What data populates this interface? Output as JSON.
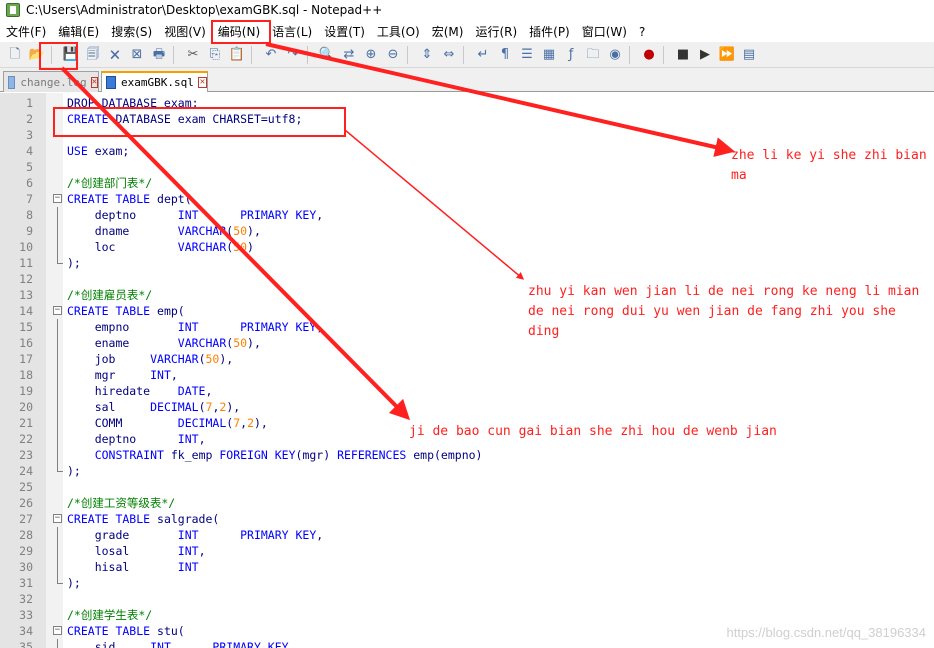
{
  "window": {
    "title": "C:\\Users\\Administrator\\Desktop\\examGBK.sql - Notepad++"
  },
  "menu": [
    "文件(F)",
    "编辑(E)",
    "搜索(S)",
    "视图(V)",
    "编码(N)",
    "语言(L)",
    "设置(T)",
    "工具(O)",
    "宏(M)",
    "运行(R)",
    "插件(P)",
    "窗口(W)",
    "?"
  ],
  "toolbar": {
    "icons": [
      "new-file-icon",
      "open-file-icon",
      "save-icon",
      "save-all-icon",
      "close-icon",
      "close-all-icon",
      "print-icon",
      "cut-icon",
      "copy-icon",
      "paste-icon",
      "undo-icon",
      "redo-icon",
      "find-icon",
      "replace-icon",
      "zoom-in-icon",
      "zoom-out-icon",
      "sync-v-icon",
      "sync-h-icon",
      "wrap-icon",
      "all-chars-icon",
      "indent-guide-icon",
      "doc-map-icon",
      "function-list-icon",
      "folder-workspace-icon",
      "monitor-icon",
      "record-macro-icon",
      "stop-record-icon",
      "play-macro-icon",
      "run-macro-multiple-icon",
      "save-macro-icon"
    ]
  },
  "tabs": [
    {
      "label": "change.log",
      "active": false
    },
    {
      "label": "examGBK.sql",
      "active": true
    }
  ],
  "lines": [
    {
      "n": "1",
      "fold": "",
      "segs": [
        {
          "t": "DROP DATABASE exam;",
          "c": "op"
        }
      ]
    },
    {
      "n": "2",
      "fold": "",
      "segs": [
        {
          "t": "CREATE",
          "c": "kw"
        },
        {
          "t": " DATABASE exam CHARSET=utf8;",
          "c": "op"
        }
      ]
    },
    {
      "n": "3",
      "fold": "",
      "segs": []
    },
    {
      "n": "4",
      "fold": "",
      "segs": [
        {
          "t": "USE",
          "c": "kw"
        },
        {
          "t": " exam;",
          "c": "op"
        }
      ]
    },
    {
      "n": "5",
      "fold": "",
      "segs": []
    },
    {
      "n": "6",
      "fold": "",
      "segs": [
        {
          "t": "/*创建部门表*/",
          "c": "cm"
        }
      ]
    },
    {
      "n": "7",
      "fold": "open",
      "segs": [
        {
          "t": "CREATE TABLE",
          "c": "kw"
        },
        {
          "t": " dept(",
          "c": "op"
        }
      ]
    },
    {
      "n": "8",
      "fold": "line",
      "segs": [
        {
          "t": "    deptno      ",
          "c": "op"
        },
        {
          "t": "INT",
          "c": "kw"
        },
        {
          "t": "      ",
          "c": "op"
        },
        {
          "t": "PRIMARY KEY",
          "c": "kw"
        },
        {
          "t": ",",
          "c": "op"
        }
      ]
    },
    {
      "n": "9",
      "fold": "line",
      "segs": [
        {
          "t": "    dname       ",
          "c": "op"
        },
        {
          "t": "VARCHAR",
          "c": "kw"
        },
        {
          "t": "(",
          "c": "op"
        },
        {
          "t": "50",
          "c": "num"
        },
        {
          "t": "),",
          "c": "op"
        }
      ]
    },
    {
      "n": "10",
      "fold": "line",
      "segs": [
        {
          "t": "    loc         ",
          "c": "op"
        },
        {
          "t": "VARCHAR",
          "c": "kw"
        },
        {
          "t": "(",
          "c": "op"
        },
        {
          "t": "50",
          "c": "num"
        },
        {
          "t": ")",
          "c": "op"
        }
      ]
    },
    {
      "n": "11",
      "fold": "end",
      "segs": [
        {
          "t": ");",
          "c": "op"
        }
      ]
    },
    {
      "n": "12",
      "fold": "",
      "segs": []
    },
    {
      "n": "13",
      "fold": "",
      "segs": [
        {
          "t": "/*创建雇员表*/",
          "c": "cm"
        }
      ]
    },
    {
      "n": "14",
      "fold": "open",
      "segs": [
        {
          "t": "CREATE TABLE",
          "c": "kw"
        },
        {
          "t": " emp(",
          "c": "op"
        }
      ]
    },
    {
      "n": "15",
      "fold": "line",
      "segs": [
        {
          "t": "    empno       ",
          "c": "op"
        },
        {
          "t": "INT",
          "c": "kw"
        },
        {
          "t": "      ",
          "c": "op"
        },
        {
          "t": "PRIMARY KEY",
          "c": "kw"
        },
        {
          "t": ",",
          "c": "op"
        }
      ]
    },
    {
      "n": "16",
      "fold": "line",
      "segs": [
        {
          "t": "    ename       ",
          "c": "op"
        },
        {
          "t": "VARCHAR",
          "c": "kw"
        },
        {
          "t": "(",
          "c": "op"
        },
        {
          "t": "50",
          "c": "num"
        },
        {
          "t": "),",
          "c": "op"
        }
      ]
    },
    {
      "n": "17",
      "fold": "line",
      "segs": [
        {
          "t": "    job     ",
          "c": "op"
        },
        {
          "t": "VARCHAR",
          "c": "kw"
        },
        {
          "t": "(",
          "c": "op"
        },
        {
          "t": "50",
          "c": "num"
        },
        {
          "t": "),",
          "c": "op"
        }
      ]
    },
    {
      "n": "18",
      "fold": "line",
      "segs": [
        {
          "t": "    mgr     ",
          "c": "op"
        },
        {
          "t": "INT",
          "c": "kw"
        },
        {
          "t": ",",
          "c": "op"
        }
      ]
    },
    {
      "n": "19",
      "fold": "line",
      "segs": [
        {
          "t": "    hiredate    ",
          "c": "op"
        },
        {
          "t": "DATE",
          "c": "kw"
        },
        {
          "t": ",",
          "c": "op"
        }
      ]
    },
    {
      "n": "20",
      "fold": "line",
      "segs": [
        {
          "t": "    sal     ",
          "c": "op"
        },
        {
          "t": "DECIMAL",
          "c": "kw"
        },
        {
          "t": "(",
          "c": "op"
        },
        {
          "t": "7",
          "c": "num"
        },
        {
          "t": ",",
          "c": "op"
        },
        {
          "t": "2",
          "c": "num"
        },
        {
          "t": "),",
          "c": "op"
        }
      ]
    },
    {
      "n": "21",
      "fold": "line",
      "segs": [
        {
          "t": "    COMM        ",
          "c": "op"
        },
        {
          "t": "DECIMAL",
          "c": "kw"
        },
        {
          "t": "(",
          "c": "op"
        },
        {
          "t": "7",
          "c": "num"
        },
        {
          "t": ",",
          "c": "op"
        },
        {
          "t": "2",
          "c": "num"
        },
        {
          "t": "),",
          "c": "op"
        }
      ]
    },
    {
      "n": "22",
      "fold": "line",
      "segs": [
        {
          "t": "    deptno      ",
          "c": "op"
        },
        {
          "t": "INT",
          "c": "kw"
        },
        {
          "t": ",",
          "c": "op"
        }
      ]
    },
    {
      "n": "23",
      "fold": "line",
      "segs": [
        {
          "t": "    ",
          "c": "op"
        },
        {
          "t": "CONSTRAINT",
          "c": "kw"
        },
        {
          "t": " fk_emp ",
          "c": "op"
        },
        {
          "t": "FOREIGN KEY",
          "c": "kw"
        },
        {
          "t": "(mgr) ",
          "c": "op"
        },
        {
          "t": "REFERENCES",
          "c": "kw"
        },
        {
          "t": " emp(empno)",
          "c": "op"
        }
      ]
    },
    {
      "n": "24",
      "fold": "end",
      "segs": [
        {
          "t": ");",
          "c": "op"
        }
      ]
    },
    {
      "n": "25",
      "fold": "",
      "segs": []
    },
    {
      "n": "26",
      "fold": "",
      "segs": [
        {
          "t": "/*创建工资等级表*/",
          "c": "cm"
        }
      ]
    },
    {
      "n": "27",
      "fold": "open",
      "segs": [
        {
          "t": "CREATE TABLE",
          "c": "kw"
        },
        {
          "t": " salgrade(",
          "c": "op"
        }
      ]
    },
    {
      "n": "28",
      "fold": "line",
      "segs": [
        {
          "t": "    grade       ",
          "c": "op"
        },
        {
          "t": "INT",
          "c": "kw"
        },
        {
          "t": "      ",
          "c": "op"
        },
        {
          "t": "PRIMARY KEY",
          "c": "kw"
        },
        {
          "t": ",",
          "c": "op"
        }
      ]
    },
    {
      "n": "29",
      "fold": "line",
      "segs": [
        {
          "t": "    losal       ",
          "c": "op"
        },
        {
          "t": "INT",
          "c": "kw"
        },
        {
          "t": ",",
          "c": "op"
        }
      ]
    },
    {
      "n": "30",
      "fold": "line",
      "segs": [
        {
          "t": "    hisal       ",
          "c": "op"
        },
        {
          "t": "INT",
          "c": "kw"
        }
      ]
    },
    {
      "n": "31",
      "fold": "end",
      "segs": [
        {
          "t": ");",
          "c": "op"
        }
      ]
    },
    {
      "n": "32",
      "fold": "",
      "segs": []
    },
    {
      "n": "33",
      "fold": "",
      "segs": [
        {
          "t": "/*创建学生表*/",
          "c": "cm"
        }
      ]
    },
    {
      "n": "34",
      "fold": "open",
      "segs": [
        {
          "t": "CREATE TABLE",
          "c": "kw"
        },
        {
          "t": " stu(",
          "c": "op"
        }
      ]
    },
    {
      "n": "35",
      "fold": "line",
      "segs": [
        {
          "t": "    sid     ",
          "c": "op"
        },
        {
          "t": "INT",
          "c": "kw"
        },
        {
          "t": "      ",
          "c": "op"
        },
        {
          "t": "PRIMARY KEY",
          "c": "kw"
        },
        {
          "t": ",",
          "c": "op"
        }
      ]
    }
  ],
  "annotations": [
    "zhe li ke yi she zhi bian ma",
    "zhu yi kan wen jian li de nei rong ke neng li mian de nei rong dui yu wen jian de fang zhi you she ding",
    "ji de bao cun gai bian she zhi hou de wenb jian"
  ],
  "annotation_color": "#ff2020",
  "watermark": "https://blog.csdn.net/qq_38196334"
}
